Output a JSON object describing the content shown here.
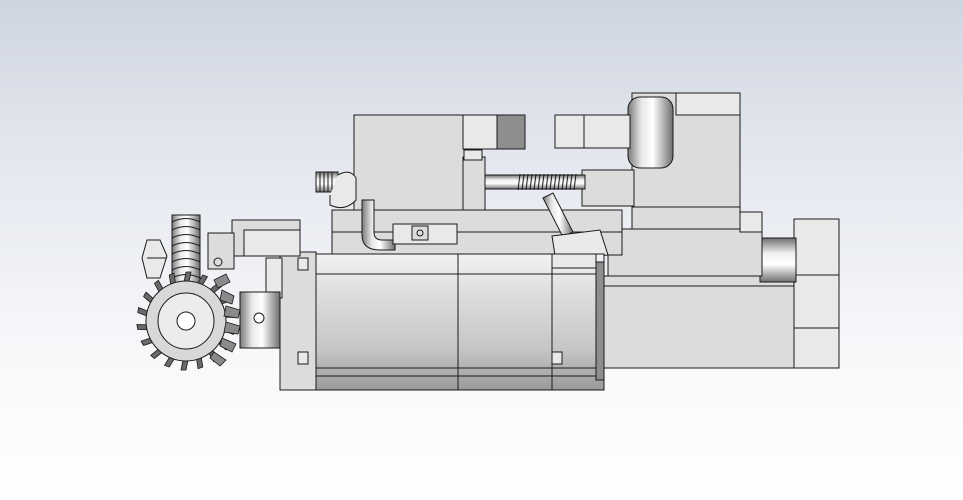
{
  "viewport": {
    "background_top": "#cfd5e0",
    "background_bottom": "#ffffff"
  },
  "model": {
    "components": [
      "servo-motor",
      "motor-flange",
      "bevel-gear",
      "worm-gear",
      "ball-screw",
      "screw-nut-block",
      "upper-housing",
      "lower-carriage",
      "coupling-disc",
      "end-bracket",
      "cable-pipe",
      "angled-bracket"
    ],
    "colors": {
      "metal_light": "#efefef",
      "metal_mid": "#cfcfcf",
      "metal_dark": "#8e8e8e",
      "edge": "#1a1a1a"
    }
  }
}
